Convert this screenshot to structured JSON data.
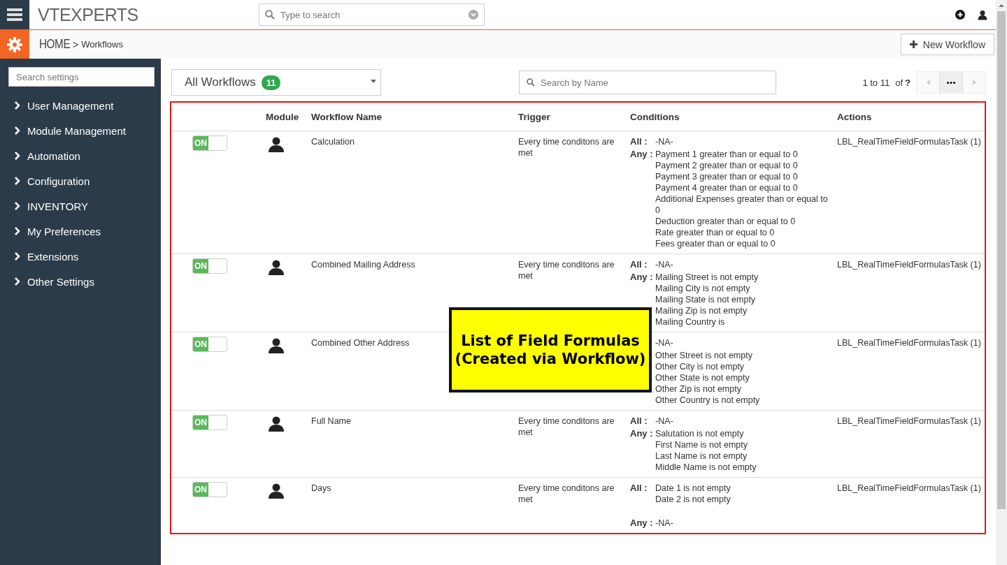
{
  "header": {
    "logo": "VTEXPERTS",
    "search": {
      "placeholder": "Type to search"
    }
  },
  "breadcrumb": {
    "home": "HOME",
    "separator": ">",
    "current": "Workflows"
  },
  "new_button": {
    "label": "New Workflow"
  },
  "sidebar": {
    "search": {
      "placeholder": "Search settings"
    },
    "items": [
      {
        "label": "User Management",
        "expanded": false
      },
      {
        "label": "Module Management",
        "expanded": false
      },
      {
        "label": "Automation",
        "expanded": false
      },
      {
        "label": "Configuration",
        "expanded": false
      },
      {
        "label": "INVENTORY",
        "expanded": false
      },
      {
        "label": "My Preferences",
        "expanded": false
      },
      {
        "label": "Extensions",
        "expanded": false
      },
      {
        "label": "Other Settings",
        "expanded": false
      }
    ]
  },
  "filter": {
    "label": "All Workflows",
    "count": "11"
  },
  "name_search": {
    "placeholder": "Search by Name"
  },
  "pagination": {
    "range": "1 to 11",
    "of": "of",
    "total": "?"
  },
  "table": {
    "columns": [
      "Module",
      "Workflow Name",
      "Trigger",
      "Conditions",
      "Actions"
    ],
    "rows": [
      {
        "on": true,
        "status": "ON",
        "name": "Calculation",
        "trigger": "Every time conditons are met",
        "conditions": [
          {
            "label": "All :",
            "items": [
              "-NA-"
            ]
          },
          {
            "label": "Any :",
            "items": [
              "Payment 1 greater than or equal to 0",
              "Payment 2 greater than or equal to 0",
              "Payment 3 greater than or equal to 0",
              "Payment 4 greater than or equal to 0",
              "Additional Expenses greater than or equal to 0",
              "Deduction greater than or equal to 0",
              "Rate greater than or equal to 0",
              "Fees greater than or equal to 0"
            ]
          }
        ],
        "action": "LBL_RealTimeFieldFormulasTask (1)"
      },
      {
        "on": true,
        "status": "ON",
        "name": "Combined Mailing Address",
        "trigger": "Every time conditons are met",
        "conditions": [
          {
            "label": "All :",
            "items": [
              "-NA-"
            ]
          },
          {
            "label": "Any :",
            "items": [
              "Mailing Street is not empty",
              "Mailing City is not empty",
              "Mailing State is not empty",
              "Mailing Zip is not empty",
              "Mailing Country is"
            ]
          }
        ],
        "action": "LBL_RealTimeFieldFormulasTask (1)"
      },
      {
        "on": true,
        "status": "ON",
        "name": "Combined Other Address",
        "conditions": [
          {
            "items": [
              "-NA-"
            ]
          },
          {
            "items": [
              "Other Street is not empty",
              "Other City is not empty",
              "Other State is not empty",
              "Other Zip is not empty",
              "Other Country is not empty"
            ]
          }
        ],
        "action": "LBL_RealTimeFieldFormulasTask (1)"
      },
      {
        "on": true,
        "status": "ON",
        "name": "Full Name",
        "trigger": "Every time conditons are met",
        "conditions": [
          {
            "label": "All :",
            "items": [
              "-NA-"
            ]
          },
          {
            "label": "Any :",
            "items": [
              "Salutation is not empty",
              "First Name is not empty",
              "Last Name is not empty",
              "Middle Name is not empty"
            ]
          }
        ],
        "action": "LBL_RealTimeFieldFormulasTask (1)"
      },
      {
        "on": true,
        "status": "ON",
        "name": "Days",
        "trigger": "Every time conditons are met",
        "conditions": [
          {
            "label": "All :",
            "items": [
              "Date 1 is not empty",
              "Date 2 is not empty"
            ]
          },
          {
            "label": "Any :",
            "items": [
              "-NA-"
            ]
          }
        ],
        "action": "LBL_RealTimeFieldFormulasTask (1)"
      }
    ]
  },
  "callout": {
    "lines": [
      "List of Field Formulas",
      "(Created via Workflow)"
    ]
  }
}
